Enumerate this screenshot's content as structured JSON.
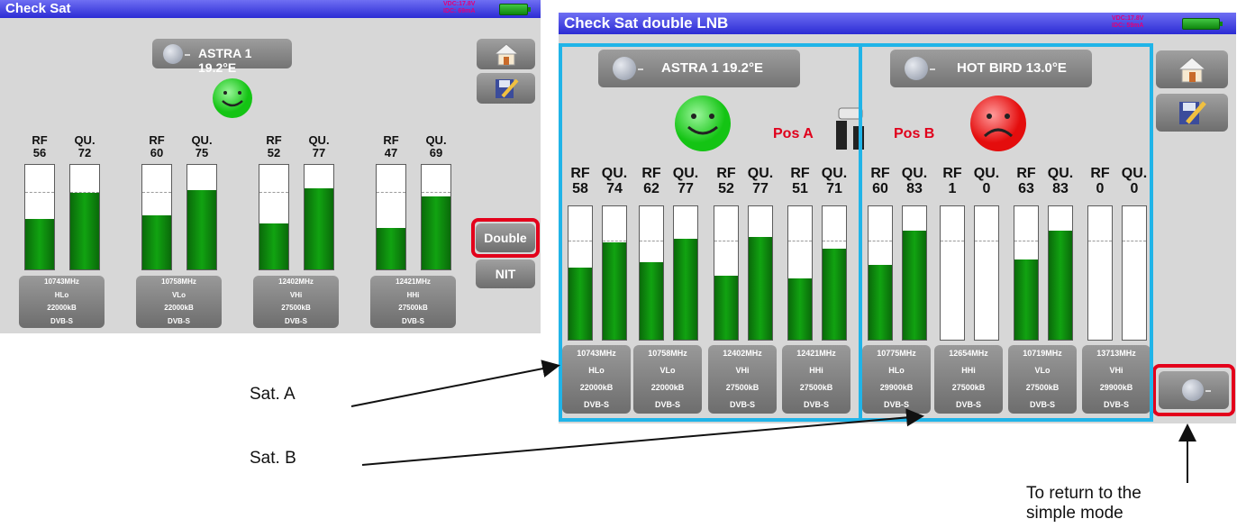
{
  "left_screen": {
    "title": "Check Sat",
    "power": "VDC:17.8V",
    "current": "IDC: 69mA",
    "satellite": "ASTRA 1 19.2°E",
    "status": "smile",
    "transponders": [
      {
        "rf_label": "RF",
        "rf": "56",
        "qu_label": "QU.",
        "qu": "72",
        "freq": "10743MHz",
        "pol": "HLo",
        "sr": "22000kB",
        "std": "DVB-S",
        "rf_level": 0.48,
        "qu_level": 0.73
      },
      {
        "rf_label": "RF",
        "rf": "60",
        "qu_label": "QU.",
        "qu": "75",
        "freq": "10758MHz",
        "pol": "VLo",
        "sr": "22000kB",
        "std": "DVB-S",
        "rf_level": 0.52,
        "qu_level": 0.76
      },
      {
        "rf_label": "RF",
        "rf": "52",
        "qu_label": "QU.",
        "qu": "77",
        "freq": "12402MHz",
        "pol": "VHi",
        "sr": "27500kB",
        "std": "DVB-S",
        "rf_level": 0.44,
        "qu_level": 0.78
      },
      {
        "rf_label": "RF",
        "rf": "47",
        "qu_label": "QU.",
        "qu": "69",
        "freq": "12421MHz",
        "pol": "HHi",
        "sr": "27500kB",
        "std": "DVB-S",
        "rf_level": 0.4,
        "qu_level": 0.7
      }
    ],
    "buttons": {
      "double": "Double",
      "nit": "NIT"
    }
  },
  "right_screen": {
    "title": "Check Sat double LNB",
    "power": "VDC:17.8V",
    "current": "IDC: 59mA",
    "sat_a": {
      "name": "ASTRA 1 19.2°E",
      "pos": "Pos A",
      "status": "smile",
      "transponders": [
        {
          "rf_label": "RF",
          "rf": "58",
          "qu_label": "QU.",
          "qu": "74",
          "freq": "10743MHz",
          "pol": "HLo",
          "sr": "22000kB",
          "std": "DVB-S",
          "rf_level": 0.54,
          "qu_level": 0.73
        },
        {
          "rf_label": "RF",
          "rf": "62",
          "qu_label": "QU.",
          "qu": "77",
          "freq": "10758MHz",
          "pol": "VLo",
          "sr": "22000kB",
          "std": "DVB-S",
          "rf_level": 0.58,
          "qu_level": 0.76
        },
        {
          "rf_label": "RF",
          "rf": "52",
          "qu_label": "QU.",
          "qu": "77",
          "freq": "12402MHz",
          "pol": "VHi",
          "sr": "27500kB",
          "std": "DVB-S",
          "rf_level": 0.48,
          "qu_level": 0.77
        },
        {
          "rf_label": "RF",
          "rf": "51",
          "qu_label": "QU.",
          "qu": "71",
          "freq": "12421MHz",
          "pol": "HHi",
          "sr": "27500kB",
          "std": "DVB-S",
          "rf_level": 0.46,
          "qu_level": 0.68
        }
      ]
    },
    "sat_b": {
      "name": "HOT BIRD 13.0°E",
      "pos": "Pos B",
      "status": "frown",
      "transponders": [
        {
          "rf_label": "RF",
          "rf": "60",
          "qu_label": "QU.",
          "qu": "83",
          "freq": "10775MHz",
          "pol": "HLo",
          "sr": "29900kB",
          "std": "DVB-S",
          "rf_level": 0.56,
          "qu_level": 0.82
        },
        {
          "rf_label": "RF",
          "rf": "1",
          "qu_label": "QU.",
          "qu": "0",
          "freq": "12654MHz",
          "pol": "HHi",
          "sr": "27500kB",
          "std": "DVB-S",
          "rf_level": 0,
          "qu_level": 0
        },
        {
          "rf_label": "RF",
          "rf": "63",
          "qu_label": "QU.",
          "qu": "83",
          "freq": "10719MHz",
          "pol": "VLo",
          "sr": "27500kB",
          "std": "DVB-S",
          "rf_level": 0.6,
          "qu_level": 0.82
        },
        {
          "rf_label": "RF",
          "rf": "0",
          "qu_label": "QU.",
          "qu": "0",
          "freq": "13713MHz",
          "pol": "VHi",
          "sr": "29900kB",
          "std": "DVB-S",
          "rf_level": 0,
          "qu_level": 0
        }
      ]
    }
  },
  "annotations": {
    "sat_a": "Sat. A",
    "sat_b": "Sat. B",
    "return_line1": "To return to the",
    "return_line2": "simple mode"
  },
  "colors": {
    "title_bar": "#2b2bd4",
    "bar_fill": "#11a311",
    "highlight_red": "#e3001b",
    "frame_blue": "#20b4e8"
  }
}
